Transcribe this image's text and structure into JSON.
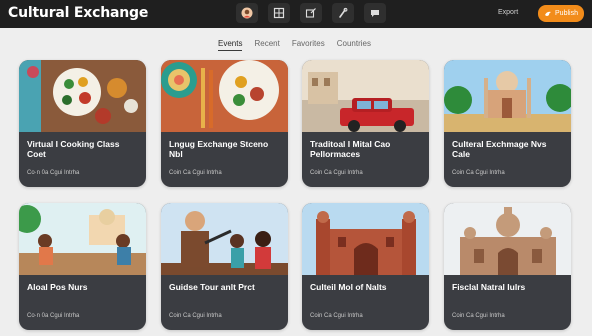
{
  "app": {
    "title": "Cultural Exchange"
  },
  "toolbar": {
    "icons": [
      "profile-icon",
      "grid-icon",
      "edit-icon",
      "tools-icon",
      "chat-icon"
    ]
  },
  "header": {
    "report_label": "Export",
    "cta_label": "Publish",
    "cta_color": "#f28c1a"
  },
  "tabs": [
    "Events",
    "Recent",
    "Favorites",
    "Countries"
  ],
  "cards": [
    {
      "title": "Virtual I Cooking Class Coet",
      "meta": "Co·n 0a Cgui Intrha"
    },
    {
      "title": "Lngug Exchange Stceno Nbl",
      "meta": "Coin Ca Cgui Intrha"
    },
    {
      "title": "Traditoal I Mital Cao Pellormaces",
      "meta": "Coin Ca Cgui Intrha"
    },
    {
      "title": "Culteral Exchmage Nvs Cale",
      "meta": "Coin Ca Cgui Intrha"
    },
    {
      "title": "Aloal Pos Nurs",
      "meta": "Co·n 0a Cgui Intrha"
    },
    {
      "title": "Guidse Tour anlt Prct",
      "meta": "Coin Ca Cgui Intrha"
    },
    {
      "title": "Culteil Mol of Nalts",
      "meta": "Coin Ca Cgui Intrha"
    },
    {
      "title": "Fisclal Natral Iulrs",
      "meta": "Coin Ca Cgui Intrha"
    }
  ]
}
